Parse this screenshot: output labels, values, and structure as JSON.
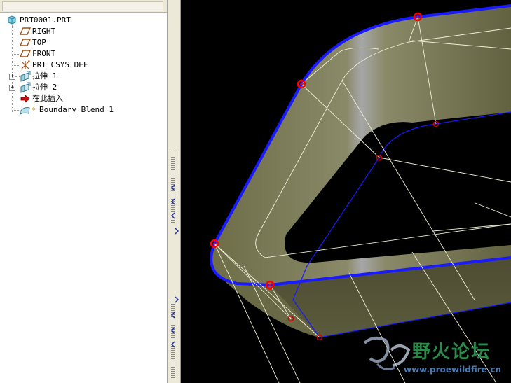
{
  "model_tree": {
    "items": [
      {
        "label": "PRT0001.PRT",
        "icon": "part-icon"
      },
      {
        "label": "RIGHT",
        "icon": "datum-plane-icon"
      },
      {
        "label": "TOP",
        "icon": "datum-plane-icon"
      },
      {
        "label": "FRONT",
        "icon": "datum-plane-icon"
      },
      {
        "label": "PRT_CSYS_DEF",
        "icon": "coordinate-system-icon"
      },
      {
        "label": "拉伸 1",
        "icon": "extrude-icon"
      },
      {
        "label": "拉伸 2",
        "icon": "extrude-icon"
      },
      {
        "label": "在此插入",
        "icon": "insert-here-arrow-icon"
      },
      {
        "label": "Boundary Blend 1",
        "icon": "boundary-blend-icon"
      }
    ]
  },
  "viewport": {
    "background": "#000000",
    "surface_color": "#6b6a45",
    "curve_color": "#1a1aff",
    "point_color": "#ff0000"
  },
  "watermark": {
    "title": "野火论坛",
    "url": "www.proewildfire.cn"
  }
}
